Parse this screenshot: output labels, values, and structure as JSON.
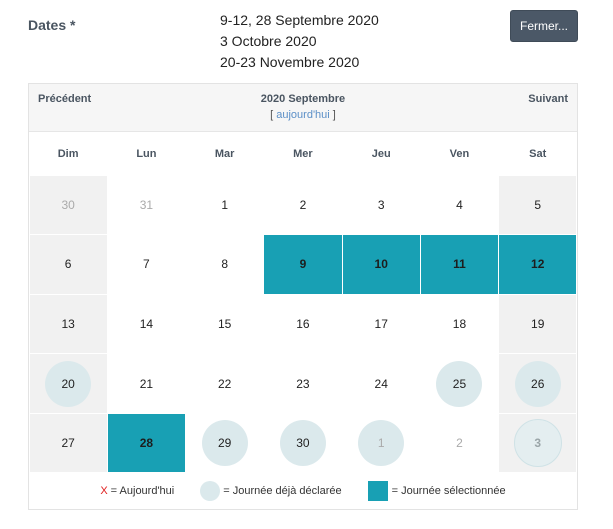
{
  "field": {
    "label": "Dates *"
  },
  "summary": [
    "9-12, 28 Septembre 2020",
    "3 Octobre 2020",
    "20-23 Novembre 2020"
  ],
  "close_button": "Fermer...",
  "calendar": {
    "prev": "Précédent",
    "next": "Suivant",
    "month_title": "2020 Septembre",
    "today_open": "[",
    "today_link": "aujourd'hui",
    "today_close": "]",
    "weekdays": [
      "Dim",
      "Lun",
      "Mar",
      "Mer",
      "Jeu",
      "Ven",
      "Sat"
    ],
    "weeks": [
      [
        {
          "d": "30",
          "o": 1
        },
        {
          "d": "31",
          "o": 1
        },
        {
          "d": "1"
        },
        {
          "d": "2"
        },
        {
          "d": "3"
        },
        {
          "d": "4"
        },
        {
          "d": "5"
        }
      ],
      [
        {
          "d": "6"
        },
        {
          "d": "7"
        },
        {
          "d": "8"
        },
        {
          "d": "9",
          "s": 1
        },
        {
          "d": "10",
          "s": 1
        },
        {
          "d": "11",
          "s": 1
        },
        {
          "d": "12",
          "s": 1
        }
      ],
      [
        {
          "d": "13"
        },
        {
          "d": "14"
        },
        {
          "d": "15"
        },
        {
          "d": "16"
        },
        {
          "d": "17"
        },
        {
          "d": "18"
        },
        {
          "d": "19"
        }
      ],
      [
        {
          "d": "20",
          "c": 1
        },
        {
          "d": "21"
        },
        {
          "d": "22"
        },
        {
          "d": "23"
        },
        {
          "d": "24"
        },
        {
          "d": "25",
          "c": 1
        },
        {
          "d": "26",
          "c": 1
        }
      ],
      [
        {
          "d": "27"
        },
        {
          "d": "28",
          "s": 1
        },
        {
          "d": "29",
          "c": 1
        },
        {
          "d": "30",
          "c": 1
        },
        {
          "d": "1",
          "o": 1,
          "c": 1
        },
        {
          "d": "2",
          "o": 1
        },
        {
          "d": "3",
          "o": 1,
          "s": 1,
          "c": 1
        }
      ]
    ]
  },
  "legend": {
    "today_mark": "X",
    "today_label": "= Aujourd'hui",
    "declared_label": "= Journée déjà déclarée",
    "selected_label": "= Journée sélectionnée"
  },
  "colors": {
    "selected": "#18a0b4",
    "declared": "#dbe9ec",
    "button": "#4b5867",
    "today_mark": "#e02020"
  }
}
